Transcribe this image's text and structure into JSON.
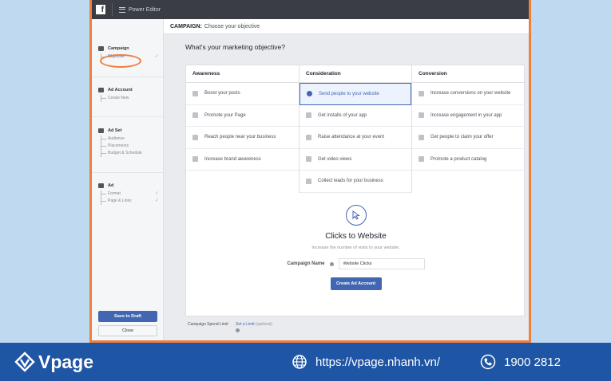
{
  "app": {
    "fb_logo": "f",
    "title": "Power Editor"
  },
  "header": {
    "section": "CAMPAIGN:",
    "subtitle": "Choose your objective"
  },
  "sidebar": {
    "campaign": {
      "label": "Campaign",
      "items": [
        {
          "label": "Objective"
        }
      ]
    },
    "ad_account": {
      "label": "Ad Account",
      "items": [
        {
          "label": "Create New"
        }
      ]
    },
    "ad_set": {
      "label": "Ad Set",
      "items": [
        {
          "label": "Audience"
        },
        {
          "label": "Placements"
        },
        {
          "label": "Budget & Schedule"
        }
      ]
    },
    "ad": {
      "label": "Ad",
      "items": [
        {
          "label": "Format"
        },
        {
          "label": "Page & Links"
        }
      ]
    },
    "save_label": "Save to Draft",
    "close_label": "Close"
  },
  "main": {
    "question": "What's your marketing objective?",
    "columns": [
      {
        "title": "Awareness",
        "items": [
          "Boost your posts",
          "Promote your Page",
          "Reach people near your business",
          "Increase brand awareness"
        ]
      },
      {
        "title": "Consideration",
        "items": [
          "Send people to your website",
          "Get installs of your app",
          "Raise attendance at your event",
          "Get video views",
          "Collect leads for your business"
        ]
      },
      {
        "title": "Conversion",
        "items": [
          "Increase conversions on your website",
          "Increase engagement in your app",
          "Get people to claim your offer",
          "Promote a product catalog"
        ]
      }
    ],
    "selected": "Send people to your website",
    "detail": {
      "title": "Clicks to Website",
      "description": "Increase the number of visits to your website.",
      "campaign_name_label": "Campaign Name",
      "campaign_name_value": "Website Clicks",
      "create_label": "Create Ad Account"
    },
    "spend_limit": {
      "label": "Campaign Spend Limit",
      "link": "Set a Limit",
      "optional": "(optional)"
    }
  },
  "footer": {
    "brand": "Vpage",
    "url": "https://vpage.nhanh.vn/",
    "phone": "1900 2812"
  },
  "colors": {
    "accent": "#4267b2",
    "highlight": "#f07f3c",
    "footer": "#1f55a5"
  }
}
